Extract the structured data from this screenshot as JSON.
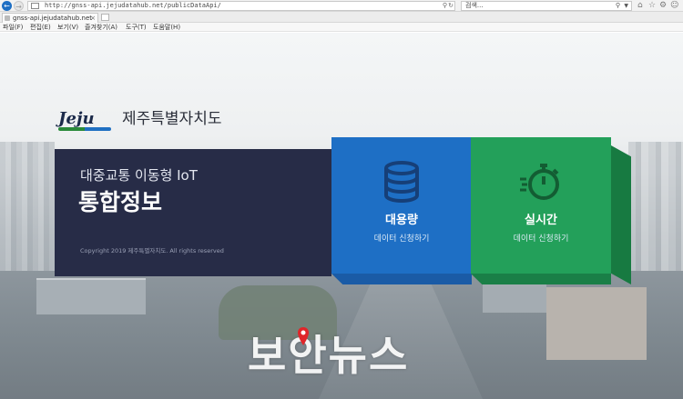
{
  "browser": {
    "url": "http://gnss-api.jejudatahub.net/publicDataApi/",
    "search_placeholder": "검색...",
    "tab_title": "gnss-api.jejudatahub.net",
    "menu": [
      "파일(F)",
      "편집(E)",
      "보기(V)",
      "즐겨찾기(A)",
      "도구(T)",
      "도움말(H)"
    ],
    "icons": {
      "back": "back-arrow-icon",
      "forward": "forward-arrow-icon",
      "refresh": "refresh-icon",
      "search": "search-icon",
      "home": "home-icon",
      "favorites": "star-icon",
      "settings": "gear-icon",
      "smiley": "smiley-icon"
    }
  },
  "page": {
    "logo_text": "Jeju",
    "logo_name": "제주특별자치도",
    "banner_subtitle": "대중교통 이동형 IoT",
    "banner_title": "통합정보",
    "copyright": "Copyright 2019 제주특별자치도. All rights reserved",
    "cards": [
      {
        "label": "대용량",
        "desc": "데이터 신청하기",
        "icon": "database-icon",
        "color": "#1e6fc5"
      },
      {
        "label": "실시간",
        "desc": "데이터 신청하기",
        "icon": "stopwatch-icon",
        "color": "#23a05a"
      }
    ]
  },
  "watermark": "보안뉴스"
}
